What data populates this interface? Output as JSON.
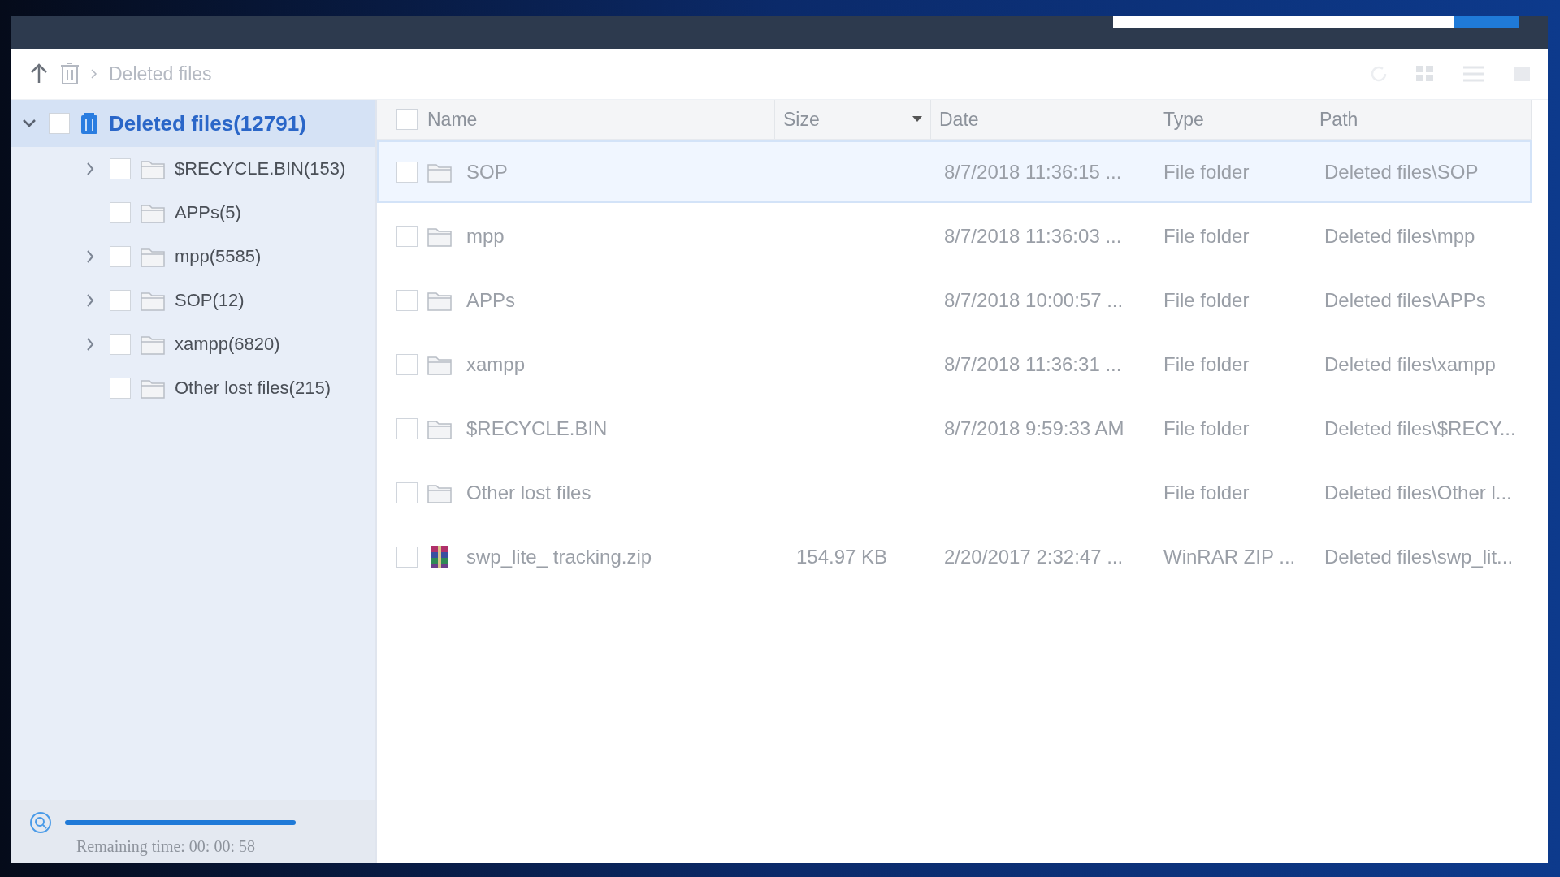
{
  "breadcrumb": {
    "label": "Deleted files"
  },
  "tree": {
    "label": "Deleted files(12791)",
    "expanded": true,
    "checked": false,
    "selected": true,
    "children": [
      {
        "label": "$RECYCLE.BIN(153)",
        "expandable": true,
        "checked": false,
        "selected": false
      },
      {
        "label": "APPs(5)",
        "expandable": false,
        "checked": false,
        "selected": false
      },
      {
        "label": "mpp(5585)",
        "expandable": true,
        "checked": false,
        "selected": false
      },
      {
        "label": "SOP(12)",
        "expandable": true,
        "checked": false,
        "selected": false
      },
      {
        "label": "xampp(6820)",
        "expandable": true,
        "checked": false,
        "selected": false
      },
      {
        "label": "Other lost files(215)",
        "expandable": false,
        "checked": false,
        "selected": false
      }
    ]
  },
  "table": {
    "select_all_checked": false,
    "columns": [
      {
        "label": "Name",
        "sorted": false
      },
      {
        "label": "Size",
        "sorted": true
      },
      {
        "label": "Date",
        "sorted": false
      },
      {
        "label": "Type",
        "sorted": false
      },
      {
        "label": "Path",
        "sorted": false
      }
    ],
    "rows": [
      {
        "kind": "folder",
        "name": "SOP",
        "date": "8/7/2018 11:36:15 ...",
        "type": "File folder",
        "path": "Deleted files\\SOP",
        "selected": true,
        "checked": false
      },
      {
        "kind": "folder",
        "name": "mpp",
        "date": "8/7/2018 11:36:03 ...",
        "type": "File folder",
        "path": "Deleted files\\mpp",
        "selected": false,
        "checked": false
      },
      {
        "kind": "folder",
        "name": "APPs",
        "date": "8/7/2018 10:00:57 ...",
        "type": "File folder",
        "path": "Deleted files\\APPs",
        "selected": false,
        "checked": false
      },
      {
        "kind": "folder",
        "name": "xampp",
        "date": "8/7/2018 11:36:31 ...",
        "type": "File folder",
        "path": "Deleted files\\xampp",
        "selected": false,
        "checked": false
      },
      {
        "kind": "folder",
        "name": "$RECYCLE.BIN",
        "date": "8/7/2018 9:59:33 AM",
        "type": "File folder",
        "path": "Deleted files\\$RECY...",
        "selected": false,
        "checked": false
      },
      {
        "kind": "folder",
        "name": "Other lost files",
        "type": "File folder",
        "path": "Deleted files\\Other l...",
        "selected": false,
        "checked": false
      },
      {
        "kind": "archive",
        "name": "swp_lite_ tracking.zip",
        "size": "154.97 KB",
        "date": "2/20/2017 2:32:47 ...",
        "type": "WinRAR ZIP ...",
        "path": "Deleted files\\swp_lit...",
        "selected": false,
        "checked": false
      }
    ]
  },
  "scan": {
    "level": 1,
    "remaining": "Remaining time: 00: 00: 58"
  }
}
